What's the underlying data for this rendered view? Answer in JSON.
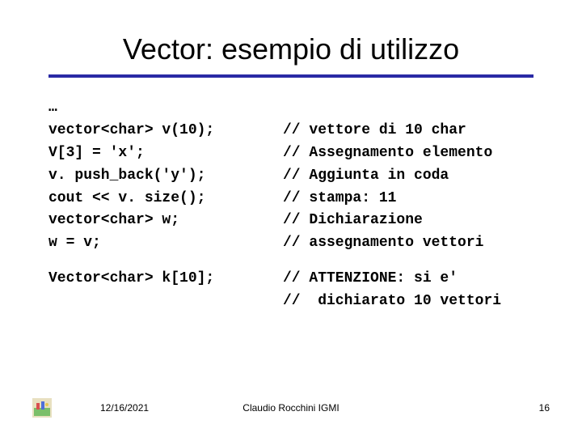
{
  "title": "Vector: esempio di utilizzo",
  "code_block_1": {
    "left": "…\nvector<char> v(10);\nV[3] = 'x';\nv. push_back('y');\ncout << v. size();\nvector<char> w;\nw = v;",
    "right": "\n// vettore di 10 char\n// Assegnamento elemento\n// Aggiunta in coda\n// stampa: 11\n// Dichiarazione\n// assegnamento vettori"
  },
  "code_block_2": {
    "left": "Vector<char> k[10];",
    "right": "// ATTENZIONE: si e'\n//  dichiarato 10 vettori"
  },
  "footer": {
    "date": "12/16/2021",
    "author": "Claudio Rocchini  IGMI",
    "page": "16"
  }
}
